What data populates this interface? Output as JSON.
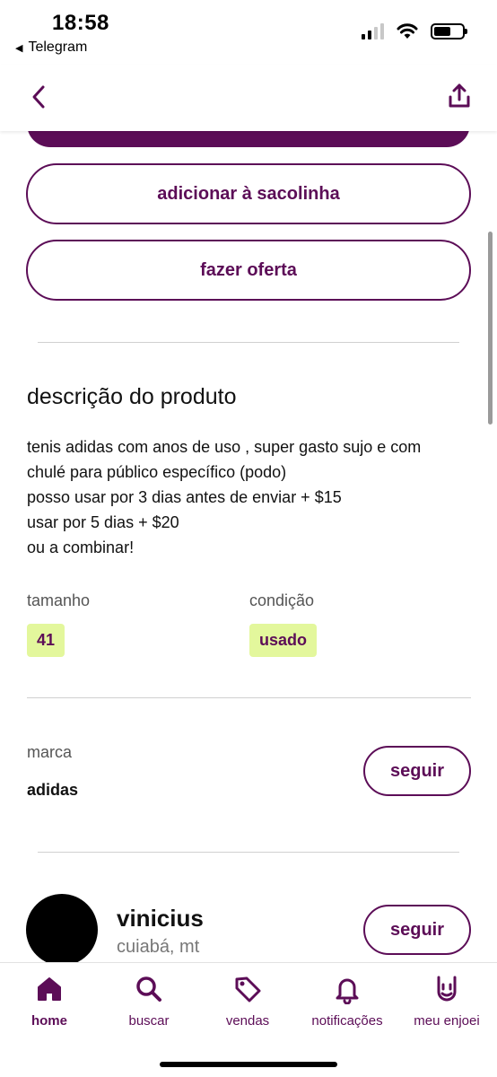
{
  "status_bar": {
    "time": "18:58",
    "back_app": "Telegram",
    "signal_icon": "cellular-signal-icon",
    "wifi_icon": "wifi-icon",
    "battery_icon": "battery-icon"
  },
  "header": {
    "back_icon": "chevron-left-icon",
    "share_icon": "share-icon"
  },
  "actions": {
    "add_to_bag": "adicionar à sacolinha",
    "make_offer": "fazer oferta"
  },
  "description": {
    "title": "descrição do produto",
    "lines": [
      "tenis adidas com anos de uso , super gasto sujo e com",
      "chulé para público específico (podo)",
      "posso usar por 3 dias antes de enviar + $15",
      "usar por 5 dias + $20",
      "ou a combinar!"
    ]
  },
  "attributes": {
    "size_label": "tamanho",
    "size_value": "41",
    "condition_label": "condição",
    "condition_value": "usado"
  },
  "brand": {
    "label": "marca",
    "value": "adidas",
    "follow": "seguir"
  },
  "seller": {
    "name": "vinicius",
    "location": "cuiabá, mt",
    "follow": "seguir"
  },
  "tab_bar": {
    "items": [
      {
        "label": "home",
        "icon": "home-icon",
        "active": true
      },
      {
        "label": "buscar",
        "icon": "search-icon",
        "active": false
      },
      {
        "label": "vendas",
        "icon": "price-tag-icon",
        "active": false
      },
      {
        "label": "notificações",
        "icon": "bell-icon",
        "active": false
      },
      {
        "label": "meu enjoei",
        "icon": "rock-hand-icon",
        "active": false
      }
    ]
  },
  "colors": {
    "brand_purple": "#5c0d57",
    "tag_background": "#e3f79c"
  }
}
